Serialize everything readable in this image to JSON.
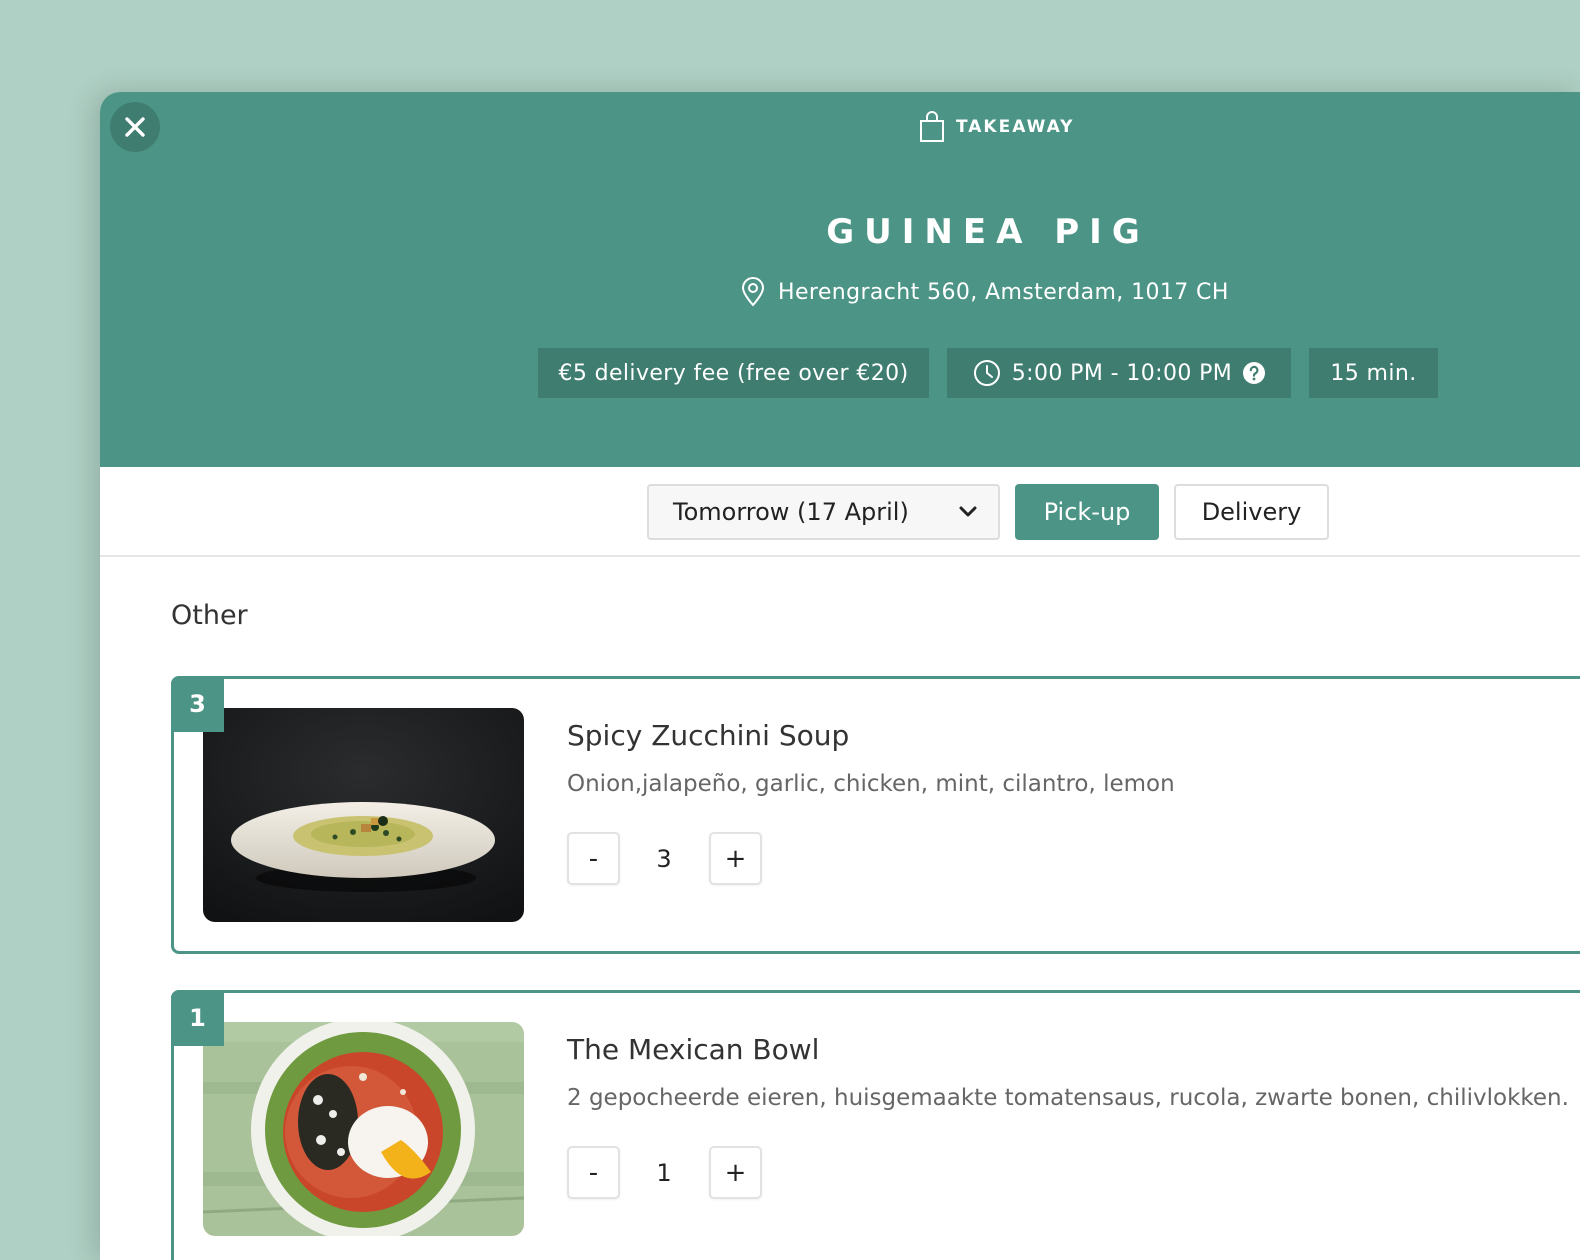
{
  "header": {
    "mode_label": "TAKEAWAY",
    "restaurant_name": "GUINEA PIG",
    "address": "Herengracht 560, Amsterdam, 1017 CH",
    "delivery_fee": "€5 delivery fee (free over €20)",
    "hours": "5:00 PM - 10:00 PM",
    "prep_time": "15 min."
  },
  "controls": {
    "date_selected": "Tomorrow (17 April)",
    "pickup_label": "Pick-up",
    "delivery_label": "Delivery",
    "active_mode": "Pick-up"
  },
  "menu": {
    "section_title": "Other",
    "items": [
      {
        "count": "3",
        "name": "Spicy Zucchini Soup",
        "description": "Onion,jalapeño, garlic, chicken, mint, cilantro, lemon",
        "quantity": "3",
        "minus_label": "-",
        "plus_label": "+"
      },
      {
        "count": "1",
        "name": "The Mexican Bowl",
        "description": "2 gepocheerde eieren, huisgemaakte tomatensaus, rucola, zwarte bonen, chilivlokken.",
        "quantity": "1",
        "minus_label": "-",
        "plus_label": "+"
      }
    ]
  },
  "icons": {
    "close": "close-icon",
    "bag": "shopping-bag-icon",
    "location": "location-pin-icon",
    "clock": "clock-icon",
    "help": "question-circle-icon",
    "dropdown": "chevron-down-icon"
  },
  "colors": {
    "page_background": "#afd0c4",
    "brand_green": "#4c9586",
    "badge_green": "#3e7d70",
    "text_dark": "#222222",
    "text_muted": "#666666"
  }
}
